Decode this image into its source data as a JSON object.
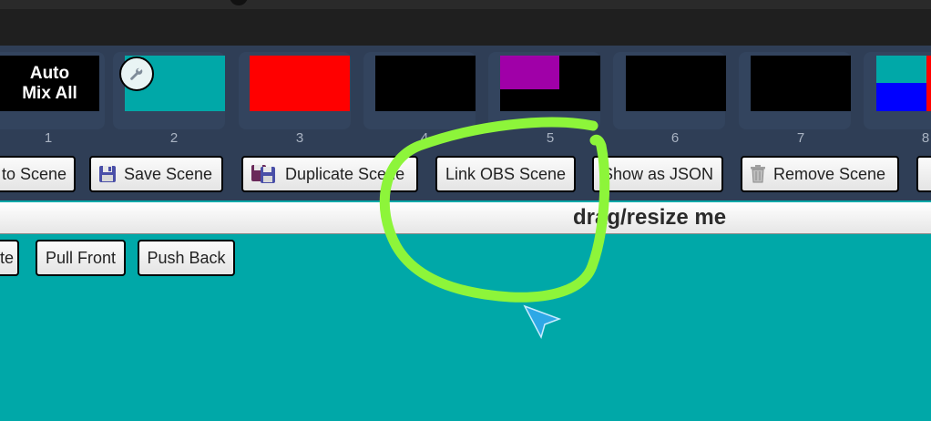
{
  "scenes": [
    {
      "number": "1",
      "label": "Auto\nMix All",
      "type": "auto"
    },
    {
      "number": "2",
      "color": "#00a8a8"
    },
    {
      "number": "3",
      "color": "#ff0000"
    },
    {
      "number": "4",
      "color": "#000000"
    },
    {
      "number": "5",
      "color": "#000000",
      "inset_color": "#a000a8"
    },
    {
      "number": "6",
      "color": "#000000"
    },
    {
      "number": "7",
      "color": "#000000"
    },
    {
      "number": "8",
      "quadrant_colors": [
        "#00a8a8",
        "#ff0000",
        "#0000ff",
        "#ff0000"
      ]
    }
  ],
  "toolbar": {
    "go_to_scene": "to Scene",
    "save_scene": "Save Scene",
    "duplicate_scene": "Duplicate Scene",
    "link_obs_scene": "Link OBS Scene",
    "show_as_json": "Show as JSON",
    "remove_scene": "Remove Scene"
  },
  "drag_handle": {
    "label": "drag/resize me"
  },
  "layer_controls": {
    "partial": "te",
    "pull_front": "Pull Front",
    "push_back": "Push Back"
  },
  "colors": {
    "canvas": "#00a8a8",
    "panel": "#2f3e56",
    "annotation": "#8df53a",
    "cursor": "#2ea8e6"
  },
  "icons": [
    "wrench-icon",
    "floppy-disk-icon",
    "duplicate-floppy-icon",
    "trash-icon",
    "cursor-arrow-icon"
  ]
}
